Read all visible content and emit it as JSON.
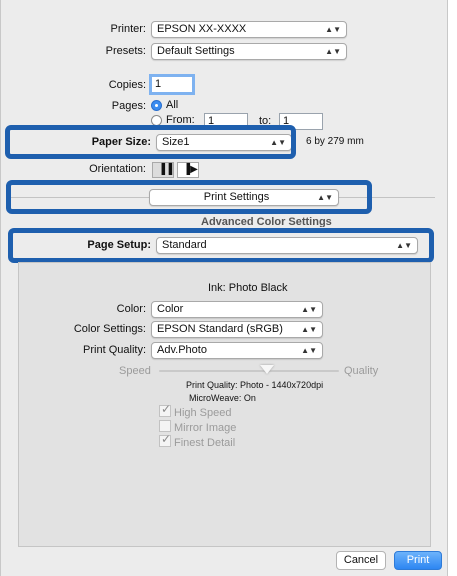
{
  "printer": {
    "label": "Printer:",
    "value": "EPSON XX-XXXX"
  },
  "presets": {
    "label": "Presets:",
    "value": "Default Settings"
  },
  "copies": {
    "label": "Copies:",
    "value": "1"
  },
  "pages": {
    "label": "Pages:",
    "all": "All",
    "from": "From:",
    "from_value": "1",
    "to": "to:",
    "to_value": "1"
  },
  "paper_size": {
    "label": "Paper Size:",
    "value": "Size1",
    "dims": "6 by 279 mm"
  },
  "orientation": {
    "label": "Orientation:"
  },
  "section": {
    "value": "Print Settings"
  },
  "hidden_row": {
    "text": "Advanced Color Settings"
  },
  "page_setup": {
    "label": "Page Setup:",
    "value": "Standard"
  },
  "ink": {
    "text": "Ink: Photo Black"
  },
  "color": {
    "label": "Color:",
    "value": "Color"
  },
  "color_settings": {
    "label": "Color Settings:",
    "value": "EPSON Standard (sRGB)"
  },
  "print_quality": {
    "label": "Print Quality:",
    "value": "Adv.Photo"
  },
  "slider": {
    "left": "Speed",
    "right": "Quality",
    "level": 0.6
  },
  "info": {
    "line1": "Print Quality: Photo - 1440x720dpi",
    "line2": "MicroWeave: On"
  },
  "checkboxes": [
    {
      "label": "High Speed",
      "checked": true
    },
    {
      "label": "Mirror Image",
      "checked": false
    },
    {
      "label": "Finest Detail",
      "checked": true
    }
  ],
  "buttons": {
    "cancel": "Cancel",
    "print": "Print"
  },
  "colors": {
    "highlight": "#1e5fae",
    "accent": "#2d86f2"
  }
}
